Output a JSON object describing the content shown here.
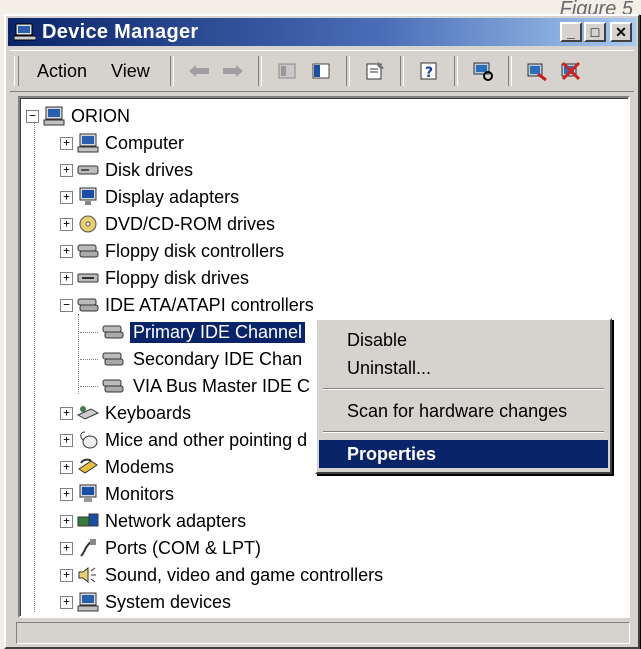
{
  "page_label": "Figure 5",
  "window": {
    "title": "Device Manager",
    "buttons": {
      "minimize": "_",
      "maximize": "□",
      "close": "✕"
    }
  },
  "toolbar": {
    "menu_action": "Action",
    "menu_view": "View",
    "icons": [
      "back-arrow-icon",
      "forward-arrow-icon",
      "show-hide-tree-icon",
      "export-list-icon",
      "properties-icon",
      "help-icon",
      "scan-hardware-icon",
      "update-driver-icon",
      "uninstall-icon"
    ]
  },
  "tree": {
    "root": "ORION",
    "categories": [
      {
        "label": "Computer",
        "icon": "computer-icon",
        "expanded": false
      },
      {
        "label": "Disk drives",
        "icon": "disk-drive-icon",
        "expanded": false
      },
      {
        "label": "Display adapters",
        "icon": "display-adapter-icon",
        "expanded": false
      },
      {
        "label": "DVD/CD-ROM drives",
        "icon": "dvd-drive-icon",
        "expanded": false
      },
      {
        "label": "Floppy disk controllers",
        "icon": "controller-icon",
        "expanded": false
      },
      {
        "label": "Floppy disk drives",
        "icon": "floppy-drive-icon",
        "expanded": false
      },
      {
        "label": "IDE ATA/ATAPI controllers",
        "icon": "controller-icon",
        "expanded": true
      },
      {
        "label": "Keyboards",
        "icon": "keyboard-icon",
        "expanded": false
      },
      {
        "label": "Mice and other pointing d",
        "icon": "mouse-icon",
        "expanded": false
      },
      {
        "label": "Modems",
        "icon": "modem-icon",
        "expanded": false
      },
      {
        "label": "Monitors",
        "icon": "monitor-icon",
        "expanded": false
      },
      {
        "label": "Network adapters",
        "icon": "network-adapter-icon",
        "expanded": false
      },
      {
        "label": "Ports (COM & LPT)",
        "icon": "port-icon",
        "expanded": false
      },
      {
        "label": "Sound, video and game controllers",
        "icon": "sound-icon",
        "expanded": false
      },
      {
        "label": "System devices",
        "icon": "system-device-icon",
        "expanded": false
      }
    ],
    "ide_children": [
      {
        "label": "Primary IDE Channel",
        "selected": true
      },
      {
        "label": "Secondary IDE Chan",
        "selected": false
      },
      {
        "label": "VIA Bus Master IDE C",
        "selected": false
      }
    ]
  },
  "context_menu": {
    "disable": "Disable",
    "uninstall": "Uninstall...",
    "scan": "Scan for hardware changes",
    "properties": "Properties"
  },
  "colors": {
    "selection": "#0a246a",
    "titlebar": "#0a246a",
    "face": "#d6d3ce"
  }
}
